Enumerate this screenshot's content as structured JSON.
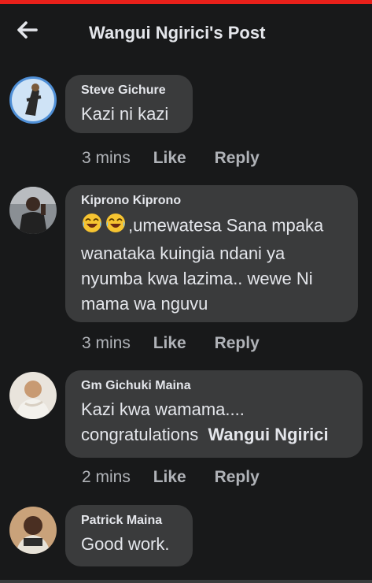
{
  "header": {
    "title": "Wangui Ngirici's Post",
    "back_icon": "arrow-left-icon"
  },
  "colors": {
    "background": "#18191a",
    "bubble": "#3a3b3c",
    "top_accent": "#e8201a",
    "text_primary": "#e4e6eb",
    "text_secondary": "#b0b3b8"
  },
  "comments": [
    {
      "author": "Steve Gichure",
      "text": "Kazi ni kazi",
      "time": "3 mins",
      "like_label": "Like",
      "reply_label": "Reply"
    },
    {
      "author": "Kiprono Kiprono",
      "emoji_icons": [
        "laughing-crying-emoji-icon",
        "laughing-crying-emoji-icon"
      ],
      "text_line1": ",umewatesa Sana mpaka",
      "text_line2": "wanataka kuingia ndani ya",
      "text_line3": "nyumba kwa lazima.. wewe Ni",
      "text_line4": "mama wa nguvu",
      "time": "3 mins",
      "like_label": "Like",
      "reply_label": "Reply"
    },
    {
      "author": "Gm Gichuki Maina",
      "text_line1": "Kazi kwa wamama....",
      "text_line2": "congratulations",
      "mention": "Wangui Ngirici",
      "time": "2 mins",
      "like_label": "Like",
      "reply_label": "Reply"
    },
    {
      "author": "Patrick Maina",
      "text": "Good work."
    }
  ]
}
